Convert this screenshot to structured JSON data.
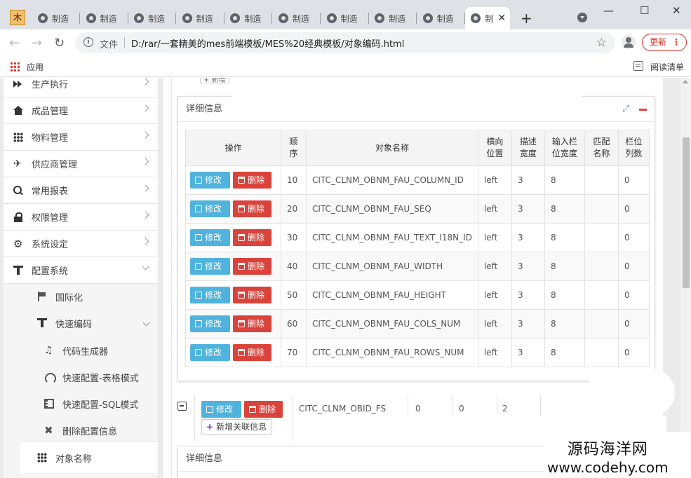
{
  "browser": {
    "app_icon": "木",
    "tabs": [
      {
        "label": "制造"
      },
      {
        "label": "制造"
      },
      {
        "label": "制造"
      },
      {
        "label": "制造"
      },
      {
        "label": "制造"
      },
      {
        "label": "制造"
      },
      {
        "label": "制造"
      },
      {
        "label": "制造"
      },
      {
        "label": "制造"
      }
    ],
    "active_tab": {
      "label": "制"
    },
    "new_tab": "+",
    "window_controls": {
      "minimize": "—",
      "maximize": "☐",
      "close": "✕"
    },
    "nav": {
      "back": "←",
      "forward": "→",
      "reload": "↻"
    },
    "address": {
      "scheme_label": "文件",
      "url": "D:/rar/一套精美的mes前端模板/MES%20经典模板/对象编码.html"
    },
    "update_button": "更新",
    "bookmarks": {
      "apps": "应用",
      "reading_list": "阅读清单"
    }
  },
  "sidebar": {
    "items": [
      {
        "label": "生产执行",
        "icon": "forward-icon"
      },
      {
        "label": "成品管理",
        "icon": "home-icon"
      },
      {
        "label": "物料管理",
        "icon": "grid-icon"
      },
      {
        "label": "供应商管理",
        "icon": "plane-icon"
      },
      {
        "label": "常用报表",
        "icon": "search-icon"
      },
      {
        "label": "权限管理",
        "icon": "lock-icon"
      },
      {
        "label": "系统设定",
        "icon": "gear-icon"
      },
      {
        "label": "配置系统",
        "icon": "filter-icon"
      }
    ],
    "sub_items": [
      {
        "label": "国际化"
      },
      {
        "label": "快速编码"
      }
    ],
    "sub_sub_items": [
      {
        "label": "代码生成器"
      },
      {
        "label": "快速配置-表格模式"
      },
      {
        "label": "快速配置-SQL模式"
      },
      {
        "label": "删除配置信息"
      }
    ],
    "object_name": {
      "label": "对象名称"
    }
  },
  "detail_panel": {
    "title": "详细信息",
    "headers": {
      "ops": "操作",
      "seq": "顺序",
      "name": "对象名称",
      "align": "横向位置",
      "desc_width": "描述宽度",
      "input_width": "输入栏位宽度",
      "match": "匹配名称",
      "cols": "栏位列数"
    },
    "edit_label": "修改",
    "delete_label": "删除",
    "rows": [
      {
        "seq": "10",
        "name": "CITC_CLNM_OBNM_FAU_COLUMN_ID",
        "align": "left",
        "desc_width": "3",
        "input_width": "8",
        "match": "",
        "cols": "0"
      },
      {
        "seq": "20",
        "name": "CITC_CLNM_OBNM_FAU_SEQ",
        "align": "left",
        "desc_width": "3",
        "input_width": "8",
        "match": "",
        "cols": "0"
      },
      {
        "seq": "30",
        "name": "CITC_CLNM_OBNM_FAU_TEXT_I18N_ID",
        "align": "left",
        "desc_width": "3",
        "input_width": "8",
        "match": "",
        "cols": "0"
      },
      {
        "seq": "40",
        "name": "CITC_CLNM_OBNM_FAU_WIDTH",
        "align": "left",
        "desc_width": "3",
        "input_width": "8",
        "match": "",
        "cols": "0"
      },
      {
        "seq": "50",
        "name": "CITC_CLNM_OBNM_FAU_HEIGHT",
        "align": "left",
        "desc_width": "3",
        "input_width": "8",
        "match": "",
        "cols": "0"
      },
      {
        "seq": "60",
        "name": "CITC_CLNM_OBNM_FAU_COLS_NUM",
        "align": "left",
        "desc_width": "3",
        "input_width": "8",
        "match": "",
        "cols": "0"
      },
      {
        "seq": "70",
        "name": "CITC_CLNM_OBNM_FAU_ROWS_NUM",
        "align": "left",
        "desc_width": "3",
        "input_width": "8",
        "match": "",
        "cols": "0"
      }
    ]
  },
  "lower_row": {
    "edit_label": "修改",
    "delete_label": "删除",
    "name": "CITC_CLNM_OBID_FS",
    "v1": "0",
    "v2": "0",
    "v3": "2",
    "add_relation": "新增关联信息"
  },
  "detail_panel_2": {
    "title": "详细信息"
  },
  "watermark": {
    "cn": "源码海洋网",
    "url": "www.codehy.com"
  }
}
